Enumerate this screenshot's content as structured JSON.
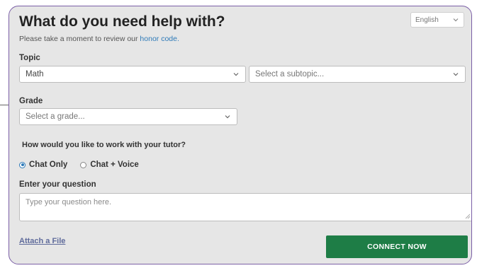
{
  "form": {
    "title": "What do you need help with?",
    "language_select": "English",
    "subtext_prefix": "Please take a moment to review our",
    "subtext_link": "honor code.",
    "topic_label": "Topic",
    "topic_value": "Math",
    "subtopic_placeholder": "Select a subtopic...",
    "grade_label": "Grade",
    "grade_placeholder": "Select a grade...",
    "mode_question": "How would you like to work with your tutor?",
    "mode_options": [
      "Chat Only",
      "Chat + Voice"
    ],
    "mode_selected": "Chat Only",
    "question_label": "Enter your question",
    "question_placeholder": "Type your question here.",
    "attach_label": "Attach a File",
    "connect_label": "CONNECT NOW"
  },
  "colors": {
    "panel_border": "#7b5fa6",
    "panel_bg": "#e6e6e6",
    "connect_button": "#1e7d46",
    "link": "#2e7ab8"
  },
  "icons": {
    "dropdown": "chevron-down-icon",
    "radio": "radio-icon",
    "resize": "resize-handle-icon"
  }
}
